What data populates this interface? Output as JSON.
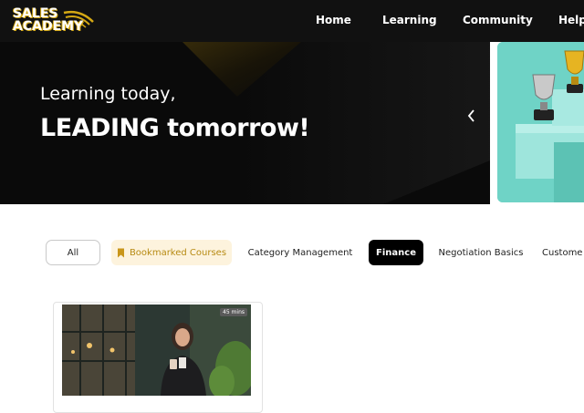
{
  "brand": {
    "logo_line1": "SALES",
    "logo_line2": "ACADEMY",
    "accent_color": "#d4a814"
  },
  "nav": {
    "items": [
      {
        "label": "Home"
      },
      {
        "label": "Learning"
      },
      {
        "label": "Community"
      },
      {
        "label": "Help C"
      }
    ]
  },
  "hero": {
    "line1": "Learning today,",
    "line2": "LEADING tomorrow!",
    "prev_icon": "chevron-left-icon"
  },
  "filters": {
    "chips": [
      {
        "label": "All"
      },
      {
        "label": "Bookmarked Courses",
        "icon": "bookmark-icon"
      },
      {
        "label": "Category Management"
      },
      {
        "label": "Finance",
        "active": true
      },
      {
        "label": "Negotiation Basics"
      },
      {
        "label": "Custome"
      }
    ]
  },
  "courses": [
    {
      "duration": "45 mins"
    }
  ]
}
